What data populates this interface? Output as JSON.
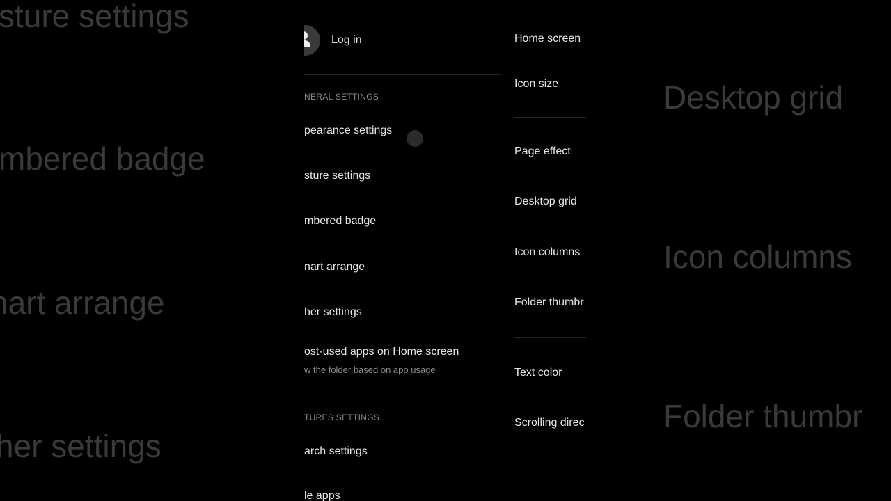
{
  "background": {
    "left": [
      "sture settings",
      "mbered badge",
      "nart arrange",
      "her settings"
    ],
    "right": [
      "Desktop grid",
      "Icon columns",
      "Folder thumbr"
    ]
  },
  "left_panel": {
    "login_label": "Log in",
    "general_header": "NERAL SETTINGS",
    "items": [
      "pearance settings",
      "sture settings",
      "mbered badge",
      "nart arrange",
      "her settings"
    ],
    "most_used": {
      "title": "ost-used apps on Home screen",
      "subtitle": "w the folder based on app usage"
    },
    "features_header": "TURES SETTINGS",
    "feature_items": [
      "arch settings",
      "le apps"
    ]
  },
  "right_panel": {
    "items": [
      "Home screen",
      "Icon size",
      "Page effect",
      "Desktop grid",
      "Icon columns",
      "Folder thumbr",
      "Text color",
      "Scrolling direc"
    ]
  }
}
